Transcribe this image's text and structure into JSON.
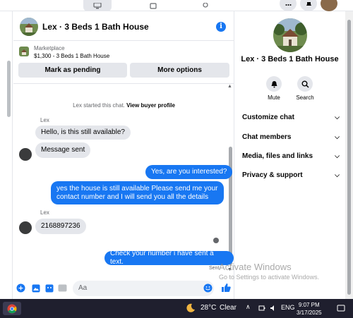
{
  "conversation": {
    "title": "Lex · 3 Beds 1 Bath House",
    "info_icon": "i"
  },
  "marketplace": {
    "label": "Marketplace",
    "listing": "$1,300 - 3 Beds 1 Bath House",
    "mark_pending": "Mark as pending",
    "more_options": "More options"
  },
  "messages": {
    "system_prefix": "Lex started this chat.",
    "system_link": "View buyer profile",
    "sender1": "Lex",
    "msg1": "Hello, is this still available?",
    "msg2": "Message sent",
    "msg3": "Yes, are you interested?",
    "msg4": "yes the house is still available Please send me your contact number and I will send you all the details",
    "sender2": "Lex",
    "msg5": "2168897236",
    "msg6": "Check your number i have sent a text.",
    "status": "Sent"
  },
  "composer": {
    "placeholder": "Aa"
  },
  "sidebar": {
    "title": "Lex · 3 Beds 1 Bath House",
    "mute": "Mute",
    "search": "Search",
    "items": [
      "Customize chat",
      "Chat members",
      "Media, files and links",
      "Privacy & support"
    ]
  },
  "watermark": {
    "line1": "Activate Windows",
    "line2": "Go to Settings to activate Windows."
  },
  "taskbar": {
    "temp": "28°C",
    "condition": "Clear",
    "lang": "ENG",
    "time": "9:07 PM",
    "date": "3/17/2025"
  },
  "colors": {
    "accent": "#1877f2",
    "bubble_in": "#e4e6eb",
    "taskbar": "#1f1f2e"
  }
}
